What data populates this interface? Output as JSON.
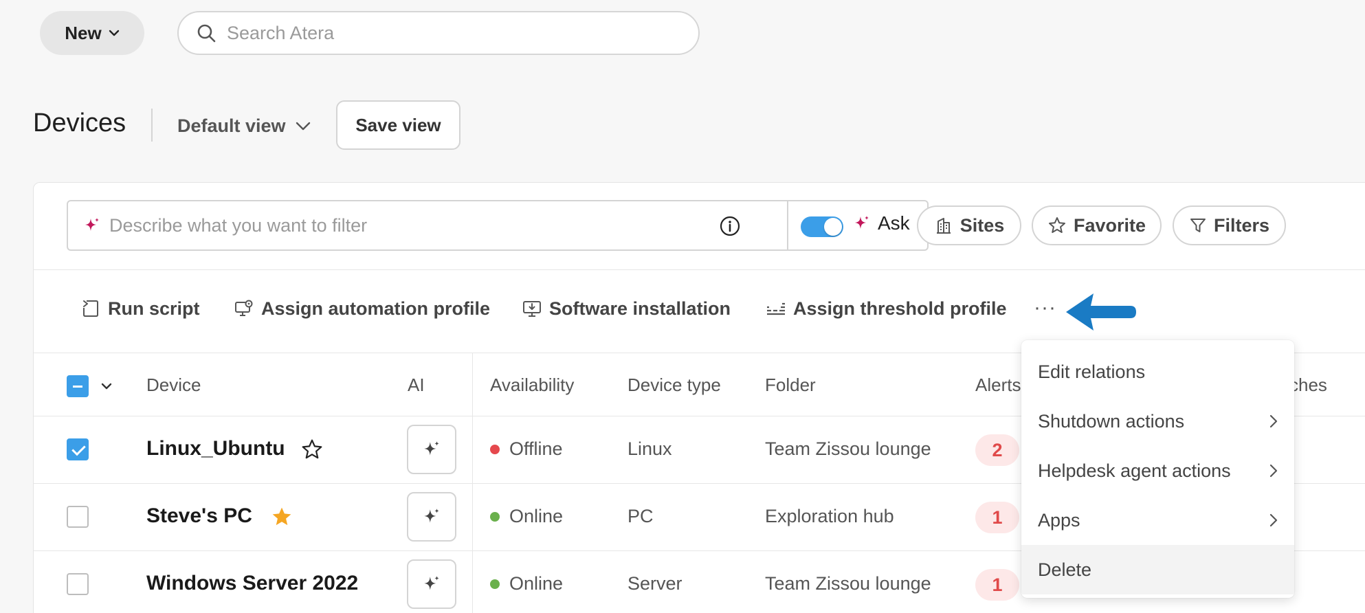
{
  "topbar": {
    "new_label": "New",
    "search_placeholder": "Search Atera"
  },
  "page": {
    "title": "Devices",
    "view_label": "Default view",
    "save_view_label": "Save view"
  },
  "ai_filter": {
    "placeholder": "Describe what you want to filter",
    "ask_label": "Ask",
    "toggle_on": true
  },
  "filters": {
    "sites": "Sites",
    "favorite": "Favorite",
    "filters": "Filters"
  },
  "actions": {
    "run_script": "Run script",
    "assign_automation": "Assign automation profile",
    "software_installation": "Software installation",
    "assign_threshold": "Assign threshold profile",
    "more": "···"
  },
  "table": {
    "headers": {
      "device": "Device",
      "ai": "AI",
      "availability": "Availability",
      "device_type": "Device type",
      "folder": "Folder",
      "alerts": "Alerts",
      "patches": "ches"
    },
    "rows": [
      {
        "name": "Linux_Ubuntu",
        "checked": true,
        "favorite": false,
        "availability": "Offline",
        "status_color": "#e5484d",
        "type": "Linux",
        "folder": "Team Zissou lounge",
        "alerts": "2"
      },
      {
        "name": "Steve's PC",
        "checked": false,
        "favorite": true,
        "availability": "Online",
        "status_color": "#6ab04c",
        "type": "PC",
        "folder": "Exploration hub",
        "alerts": "1"
      },
      {
        "name": "Windows Server 2022",
        "checked": false,
        "favorite": false,
        "availability": "Online",
        "status_color": "#6ab04c",
        "type": "Server",
        "folder": "Team Zissou lounge",
        "alerts": "1"
      }
    ]
  },
  "menu": {
    "items": [
      {
        "label": "Edit relations",
        "submenu": false
      },
      {
        "label": "Shutdown actions",
        "submenu": true
      },
      {
        "label": "Helpdesk agent actions",
        "submenu": true
      },
      {
        "label": "Apps",
        "submenu": true
      },
      {
        "label": "Delete",
        "submenu": false
      }
    ]
  },
  "colors": {
    "accent": "#3b9ee8",
    "spark": "#c2185b",
    "annotation_arrow": "#1a7bc4",
    "favorite_star": "#f5a623",
    "alert_text": "#e04a4a",
    "alert_bg": "#fde8e8"
  }
}
